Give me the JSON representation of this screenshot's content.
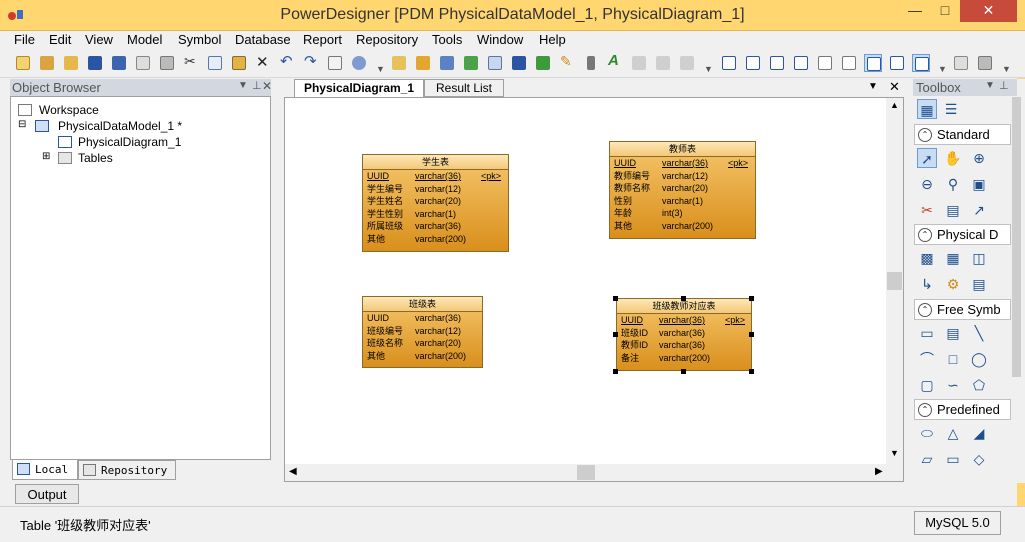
{
  "window": {
    "title": "PowerDesigner [PDM PhysicalDataModel_1, PhysicalDiagram_1]"
  },
  "menu": [
    "File",
    "Edit",
    "View",
    "Model",
    "Symbol",
    "Database",
    "Report",
    "Repository",
    "Tools",
    "Window",
    "Help"
  ],
  "object_browser": {
    "title": "Object Browser",
    "tree": {
      "workspace": "Workspace",
      "model": "PhysicalDataModel_1 *",
      "diagram": "PhysicalDiagram_1",
      "tables": "Tables"
    },
    "tabs": [
      "Local",
      "Repository"
    ]
  },
  "diagram_tabs": [
    "PhysicalDiagram_1",
    "Result List"
  ],
  "tables": [
    {
      "name": "学生表",
      "columns": [
        {
          "name": "UUID",
          "type": "varchar(36)",
          "key": "<pk>"
        },
        {
          "name": "学生编号",
          "type": "varchar(12)",
          "key": ""
        },
        {
          "name": "学生姓名",
          "type": "varchar(20)",
          "key": ""
        },
        {
          "name": "学生性别",
          "type": "varchar(1)",
          "key": ""
        },
        {
          "name": "所属班级",
          "type": "varchar(36)",
          "key": ""
        },
        {
          "name": "其他",
          "type": "varchar(200)",
          "key": ""
        }
      ]
    },
    {
      "name": "教师表",
      "columns": [
        {
          "name": "UUID",
          "type": "varchar(36)",
          "key": "<pk>"
        },
        {
          "name": "教师编号",
          "type": "varchar(12)",
          "key": ""
        },
        {
          "name": "教师名称",
          "type": "varchar(20)",
          "key": ""
        },
        {
          "name": "性别",
          "type": "varchar(1)",
          "key": ""
        },
        {
          "name": "年龄",
          "type": "int(3)",
          "key": ""
        },
        {
          "name": "其他",
          "type": "varchar(200)",
          "key": ""
        }
      ]
    },
    {
      "name": "班级表",
      "columns": [
        {
          "name": "UUID",
          "type": "varchar(36)",
          "key": ""
        },
        {
          "name": "班级编号",
          "type": "varchar(12)",
          "key": ""
        },
        {
          "name": "班级名称",
          "type": "varchar(20)",
          "key": ""
        },
        {
          "name": "其他",
          "type": "varchar(200)",
          "key": ""
        }
      ]
    },
    {
      "name": "班级教师对应表",
      "columns": [
        {
          "name": "UUID",
          "type": "varchar(36)",
          "key": "<pk>"
        },
        {
          "name": "班级ID",
          "type": "varchar(36)",
          "key": ""
        },
        {
          "name": "教师ID",
          "type": "varchar(36)",
          "key": ""
        },
        {
          "name": "备注",
          "type": "varchar(200)",
          "key": ""
        }
      ]
    }
  ],
  "toolbox": {
    "title": "Toolbox",
    "sections": [
      "Standard",
      "Physical D",
      "Free Symb",
      "Predefined"
    ]
  },
  "output_tab": "Output",
  "status": {
    "text": "Table '班级教师对应表'",
    "dbms": "MySQL 5.0"
  }
}
